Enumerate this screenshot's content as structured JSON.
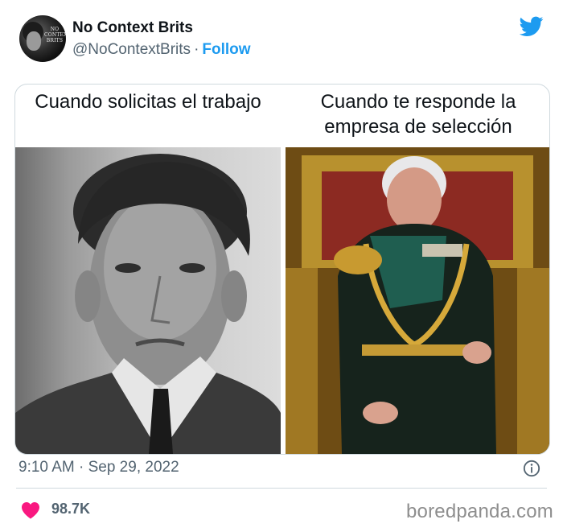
{
  "tweet": {
    "author": {
      "display_name": "No Context Brits",
      "handle": "@NoContextBrits",
      "separator": "·",
      "follow_label": "Follow",
      "avatar_text": "NO\nCONTEXT\nBRITS"
    },
    "media": {
      "caption_left": "Cuando solicitas el trabajo",
      "caption_right": "Cuando te responde la empresa de selección",
      "left_photo": "black-and-white portrait of a young man in a suit and tie",
      "right_photo": "older man in ceremonial military uniform seated on a golden throne"
    },
    "timestamp": "9:10 AM · Sep 29, 2022",
    "likes": "98.7K"
  },
  "watermark": "boredpanda.com",
  "icons": {
    "brand": "twitter-bird-icon",
    "info": "info-icon",
    "like": "heart-icon"
  },
  "colors": {
    "twitter_blue": "#1d9bf0",
    "heart_pink": "#f91880",
    "secondary_text": "#536471",
    "border": "#cfd9de"
  }
}
